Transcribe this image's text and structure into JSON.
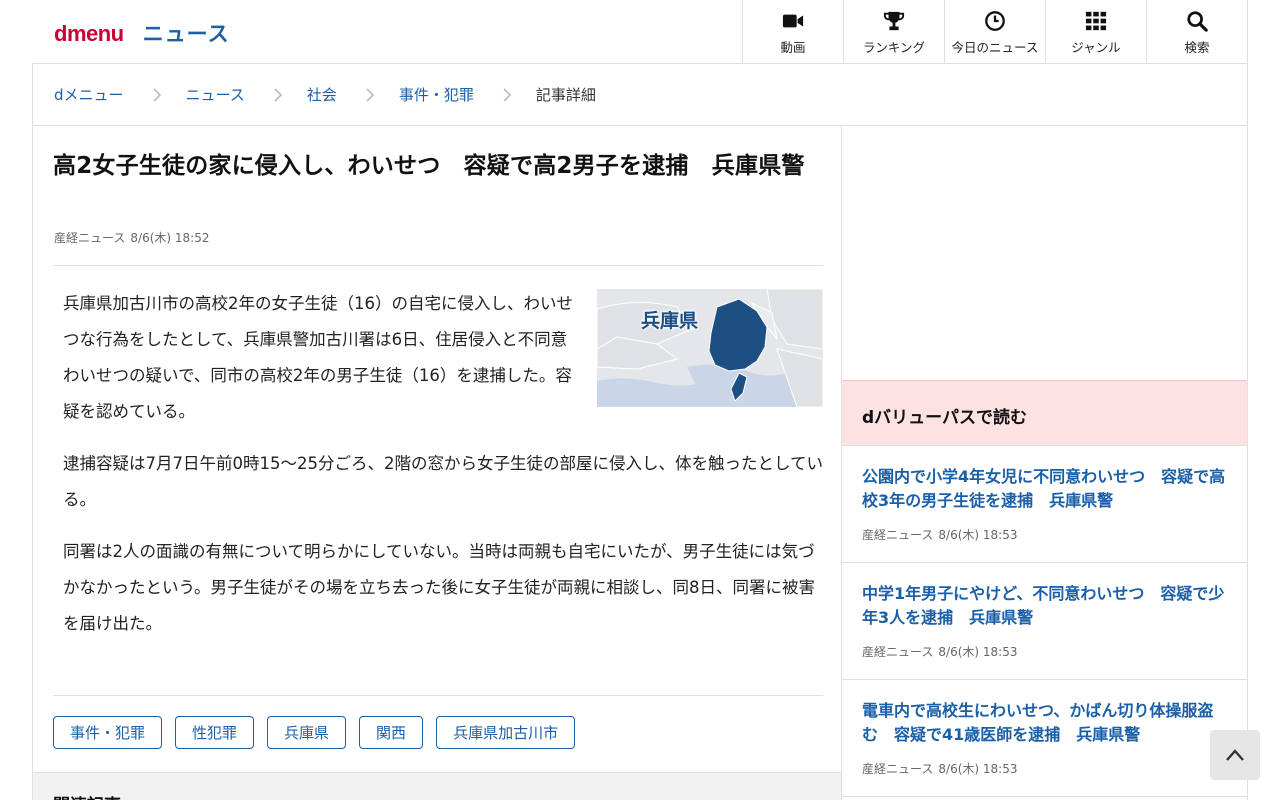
{
  "header": {
    "logo_brand": "dmenu",
    "logo_section": "ニュース",
    "nav": [
      {
        "label": "動画",
        "icon": "video-camera-icon"
      },
      {
        "label": "ランキング",
        "icon": "trophy-icon"
      },
      {
        "label": "今日のニュース",
        "icon": "clock-icon"
      },
      {
        "label": "ジャンル",
        "icon": "grid-icon"
      },
      {
        "label": "検索",
        "icon": "search-icon"
      }
    ]
  },
  "breadcrumb": [
    "dメニュー",
    "ニュース",
    "社会",
    "事件・犯罪",
    "記事詳細"
  ],
  "article": {
    "title": "高2女子生徒の家に侵入し、わいせつ　容疑で高2男子を逮捕　兵庫県警",
    "source": "産経ニュース",
    "date": "8/6(木) 18:52",
    "map_label": "兵庫県",
    "paragraphs": [
      "兵庫県加古川市の高校2年の女子生徒（16）の自宅に侵入し、わいせつな行為をしたとして、兵庫県警加古川署は6日、住居侵入と不同意わいせつの疑いで、同市の高校2年の男子生徒（16）を逮捕した。容疑を認めている。",
      "逮捕容疑は7月7日午前0時15〜25分ごろ、2階の窓から女子生徒の部屋に侵入し、体を触ったとしている。",
      "同署は2人の面識の有無について明らかにしていない。当時は両親も自宅にいたが、男子生徒には気づかなかったという。男子生徒がその場を立ち去った後に女子生徒が両親に相談し、同8日、同署に被害を届け出た。"
    ],
    "tags": [
      "事件・犯罪",
      "性犯罪",
      "兵庫県",
      "関西",
      "兵庫県加古川市"
    ]
  },
  "related": {
    "title": "関連記事"
  },
  "sidebar": {
    "dvalue_title": "dバリューパスで読む",
    "items": [
      {
        "title": "公園内で小学4年女児に不同意わいせつ　容疑で高校3年の男子生徒を逮捕　兵庫県警",
        "source": "産経ニュース",
        "date": "8/6(木) 18:53"
      },
      {
        "title": "中学1年男子にやけど、不同意わいせつ　容疑で少年3人を逮捕　兵庫県警",
        "source": "産経ニュース",
        "date": "8/6(木) 18:53"
      },
      {
        "title": "電車内で高校生にわいせつ、かばん切り体操服盗む　容疑で41歳医師を逮捕　兵庫県警",
        "source": "産経ニュース",
        "date": "8/6(木) 18:53"
      }
    ]
  },
  "colors": {
    "brand_red": "#cc0033",
    "link_blue": "#1a5fa8",
    "map_fill": "#1d4f82",
    "dvalue_bg": "#fde1e3"
  }
}
